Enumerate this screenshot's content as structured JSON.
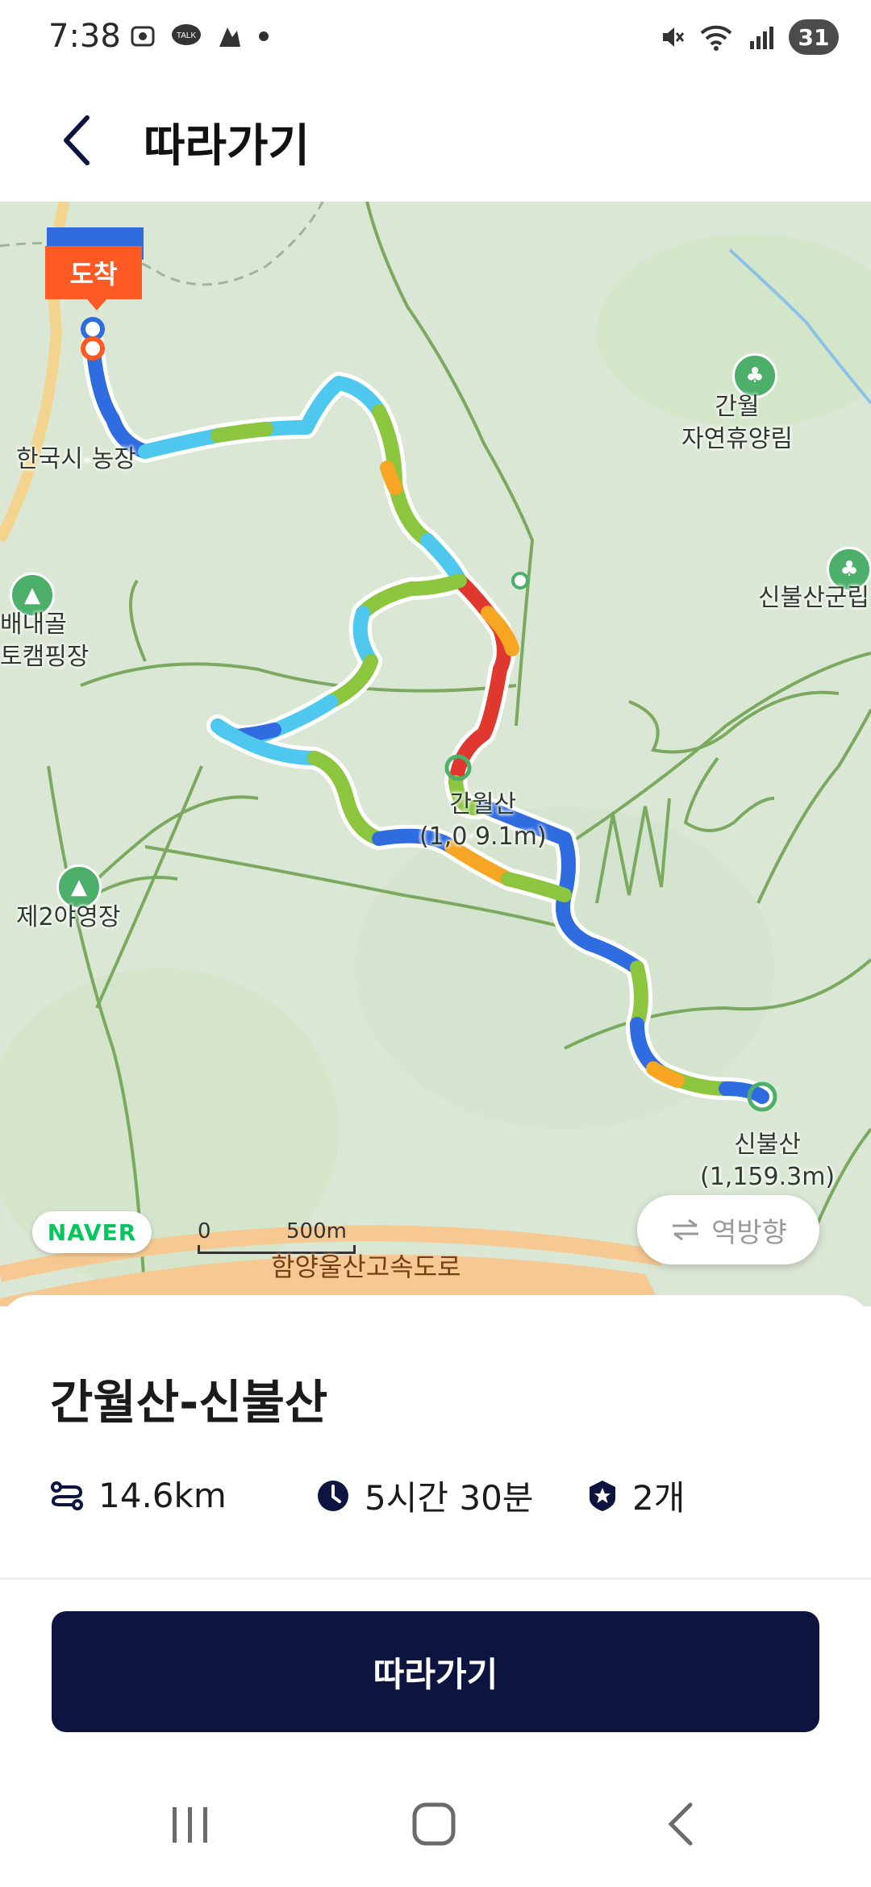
{
  "status_bar": {
    "time": "7:38",
    "left_icons": [
      "screenshot-icon",
      "kakaotalk-icon",
      "app-icon",
      "dot-icon"
    ],
    "right_icons": [
      "mute-icon",
      "wifi-icon",
      "signal-icon"
    ],
    "battery": "31"
  },
  "header": {
    "title": "따라가기",
    "back_icon": "chevron-left-icon"
  },
  "map": {
    "arrival_badge": "도착",
    "labels": {
      "farm": "한국시",
      "farm_suffix": "농장",
      "forest": "간월\n자연휴양림",
      "baenaegol_1": "배내골",
      "baenaegol_2": "토캠핑장",
      "shinbulsan_camp": "신불산군립",
      "ganwolsan_name": "간월산",
      "ganwolsan_height": "(1,0",
      "ganwolsan_height_end": "9.1m)",
      "camp2": "제2야영장",
      "shinbulsan_name": "신불산",
      "shinbulsan_height": "(1,159.3m)",
      "road": "함양울산고속도로"
    },
    "naver_logo": "NAVER",
    "scale": {
      "zero": "0",
      "distance": "500m"
    },
    "reverse_button": "역방향",
    "colors": {
      "route_blue": "#2f6ce0",
      "route_cyan": "#4ec8ef",
      "route_green": "#8cc63f",
      "route_red": "#e0372e",
      "route_orange": "#f6a623",
      "map_bg": "#dbe7d5"
    }
  },
  "route": {
    "name": "간월산-신불산",
    "distance": "14.6km",
    "duration": "5시간 30분",
    "badges": "2개"
  },
  "action": {
    "follow_label": "따라가기",
    "button_color": "#0c143f"
  }
}
